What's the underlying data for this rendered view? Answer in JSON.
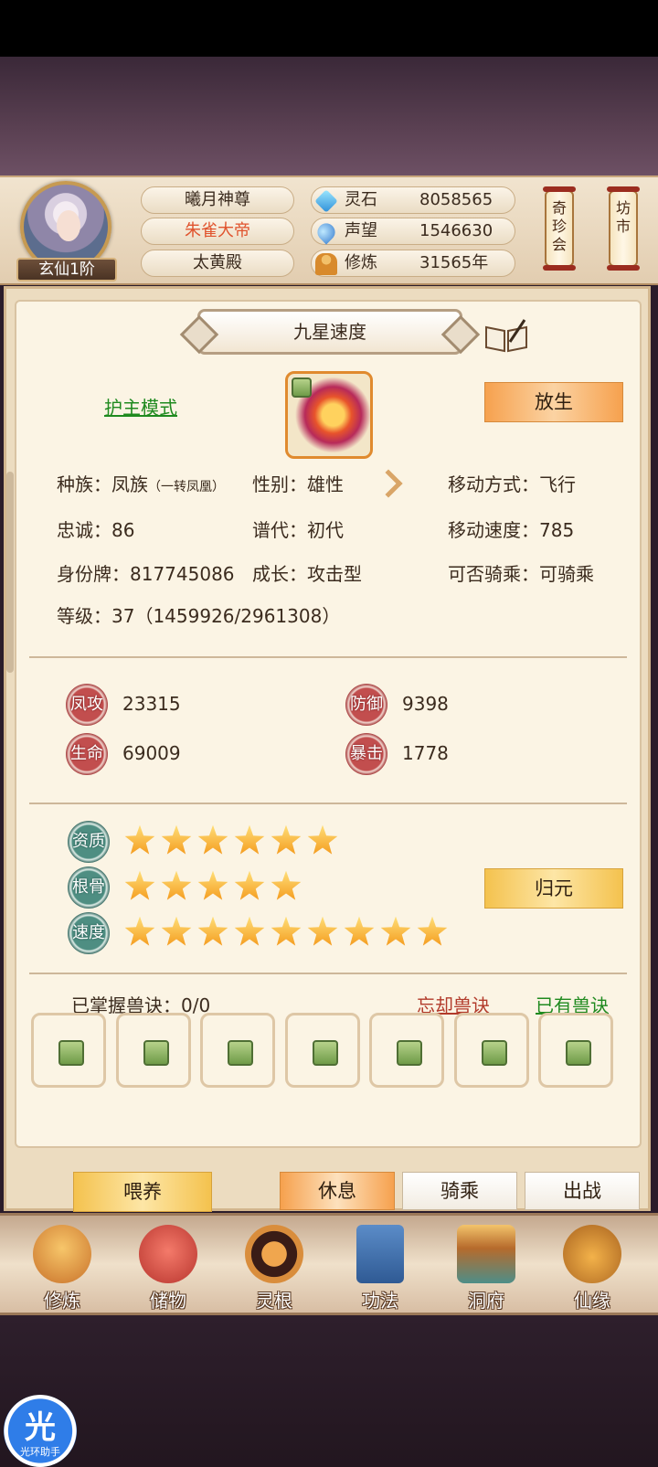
{
  "header": {
    "rank": "玄仙1阶",
    "titles": [
      "曦月神尊",
      "朱雀大帝",
      "太黄殿"
    ],
    "stats": [
      {
        "icon": "spirit-stone-icon",
        "label": "灵石",
        "value": "8058565"
      },
      {
        "icon": "reputation-icon",
        "label": "声望",
        "value": "1546630"
      },
      {
        "icon": "cultivation-icon",
        "label": "修炼",
        "value": "31565年"
      }
    ],
    "lantern_left": "奇珍会",
    "lantern_right": "坊市"
  },
  "pet": {
    "name": "九星速度",
    "guard_mode": "护主模式",
    "release_label": "放生",
    "race_label": "种族：凤族",
    "race_sub": "（一转凤凰）",
    "gender": "性别：雄性",
    "move_type": "移动方式：飞行",
    "loyalty": "忠诚：86",
    "generation": "谱代：初代",
    "move_speed": "移动速度：785",
    "id_tag": "身份牌：817745086",
    "growth": "成长：攻击型",
    "rideable": "可否骑乘：可骑乘",
    "level": "等级：37（1459926/2961308）"
  },
  "combat": [
    {
      "badge": "凤攻",
      "value": "23315"
    },
    {
      "badge": "防御",
      "value": "9398"
    },
    {
      "badge": "生命",
      "value": "69009"
    },
    {
      "badge": "暴击",
      "value": "1778"
    }
  ],
  "talents": [
    {
      "badge": "资质",
      "stars": 6
    },
    {
      "badge": "根骨",
      "stars": 5
    },
    {
      "badge": "速度",
      "stars": 9
    }
  ],
  "return_label": "归元",
  "skills": {
    "mastered": "已掌握兽诀：0/0",
    "forget": "忘却兽诀",
    "owned": "已有兽诀",
    "slots": 7
  },
  "actions": {
    "feed": "喂养",
    "rest": "休息",
    "ride": "骑乘",
    "battle": "出战"
  },
  "nav": [
    "修炼",
    "储物",
    "灵根",
    "功法",
    "洞府",
    "仙缘"
  ],
  "helper": {
    "glyph": "光",
    "label": "光环助手"
  }
}
